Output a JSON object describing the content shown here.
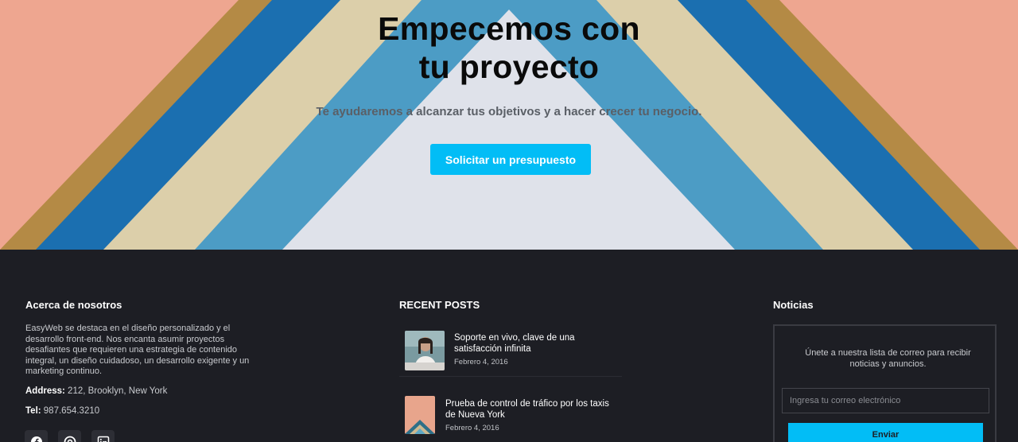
{
  "hero": {
    "title_line1": "Empecemos con",
    "title_line2": "tu proyecto",
    "subtitle": "Te ayudaremos a alcanzar tus objetivos y a hacer crecer tu negocio.",
    "cta_label": "Solicitar un presupuesto"
  },
  "about": {
    "title": "Acerca de nosotros",
    "text": "EasyWeb se destaca en el diseño personalizado y el desarrollo front-end. Nos encanta asumir proyectos desafiantes que requieren una estrategia de contenido integral, un diseño cuidadoso, un desarrollo exigente y un marketing continuo.",
    "address_label": "Address:",
    "address_value": " 212, Brooklyn, New York",
    "tel_label": "Tel:",
    "tel_value": " 987.654.3210",
    "social": [
      "facebook-icon",
      "dribbble-icon",
      "linkedin-icon"
    ]
  },
  "recent_posts": {
    "title": "RECENT POSTS",
    "posts": [
      {
        "title": "Soporte en vivo, clave de una satisfacción infinita",
        "date": "Febrero 4, 2016"
      },
      {
        "title": "Prueba de control de tráfico por los taxis de Nueva York",
        "date": "Febrero 4, 2016"
      }
    ]
  },
  "newsletter": {
    "title": "Noticias",
    "text": "Únete a nuestra lista de correo para recibir noticias y anuncios.",
    "placeholder": "Ingresa tu correo electrónico",
    "button_label": "Enviar"
  },
  "colors": {
    "accent": "#02bdf6",
    "footer_bg": "#1d1e24"
  }
}
